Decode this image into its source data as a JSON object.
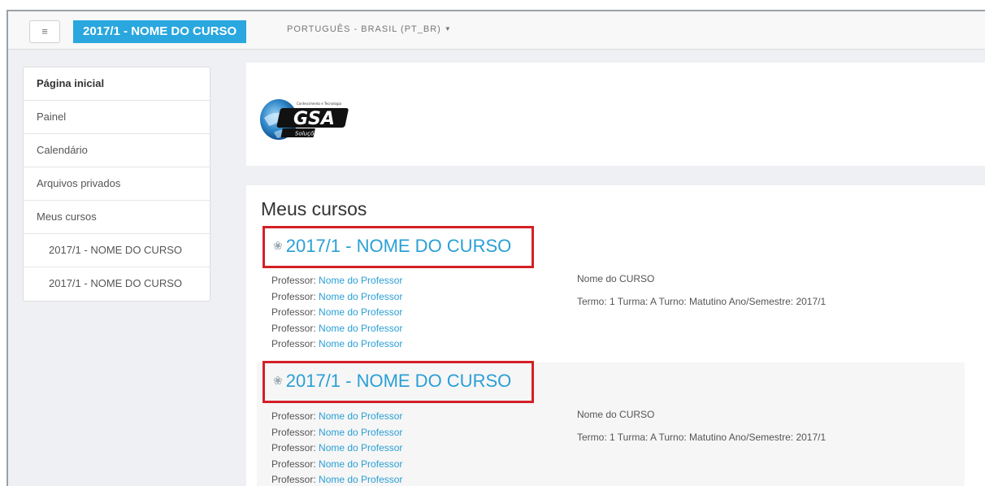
{
  "navbar": {
    "menu_icon": "hamburger-icon",
    "brand": "2017/1 - NOME DO CURSO",
    "language": "PORTUGUÊS - BRASIL (PT_BR)"
  },
  "sidebar": {
    "items": [
      {
        "label": "Página inicial"
      },
      {
        "label": "Painel"
      },
      {
        "label": "Calendário"
      },
      {
        "label": "Arquivos privados"
      },
      {
        "label": "Meus cursos"
      },
      {
        "label": "2017/1 - NOME DO CURSO"
      },
      {
        "label": "2017/1 - NOME DO CURSO"
      }
    ]
  },
  "logo": {
    "text": "GSA",
    "subtitle": "Soluções",
    "tagline": "Conhecimento e Tecnologia"
  },
  "courses": {
    "title": "Meus cursos",
    "items": [
      {
        "name": "2017/1 - NOME DO CURSO",
        "professor_label": "Professor:",
        "professors": [
          "Nome do Professor",
          "Nome do Professor",
          "Nome do Professor",
          "Nome do Professor",
          "Nome do Professor"
        ],
        "summary": "Nome do CURSO",
        "details": "Termo: 1 Turma: A Turno: Matutino Ano/Semestre: 2017/1"
      },
      {
        "name": "2017/1 - NOME DO CURSO",
        "professor_label": "Professor:",
        "professors": [
          "Nome do Professor",
          "Nome do Professor",
          "Nome do Professor",
          "Nome do Professor",
          "Nome do Professor"
        ],
        "summary": "Nome do CURSO",
        "details": "Termo: 1 Turma: A Turno: Matutino Ano/Semestre: 2017/1"
      }
    ]
  },
  "colors": {
    "brand": "#29a7de",
    "link": "#2a9fd6",
    "highlight": "#d32027"
  }
}
